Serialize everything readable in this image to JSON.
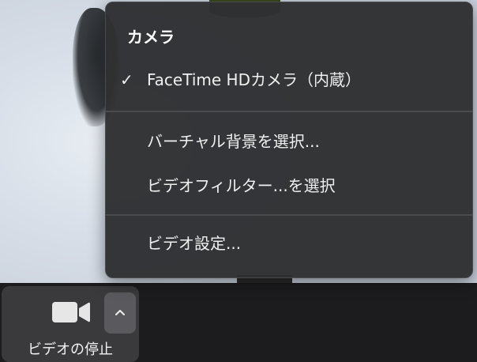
{
  "menu": {
    "header": "カメラ",
    "items": [
      {
        "label": "FaceTime HDカメラ（内蔵）",
        "checked": true
      },
      {
        "label": "バーチャル背景を選択..."
      },
      {
        "label": "ビデオフィルター...を選択"
      },
      {
        "label": "ビデオ設定..."
      }
    ]
  },
  "toolbar": {
    "video_label": "ビデオの停止",
    "camera_icon": "video-camera-icon",
    "chevron_icon": "chevron-up-icon"
  },
  "colors": {
    "menu_bg": "#2e2f32",
    "toolbar_bg": "#1c1c1e",
    "button_bg": "#3a3a3c",
    "chevron_bg": "#5a5a5e",
    "text": "#f0f0f0"
  }
}
